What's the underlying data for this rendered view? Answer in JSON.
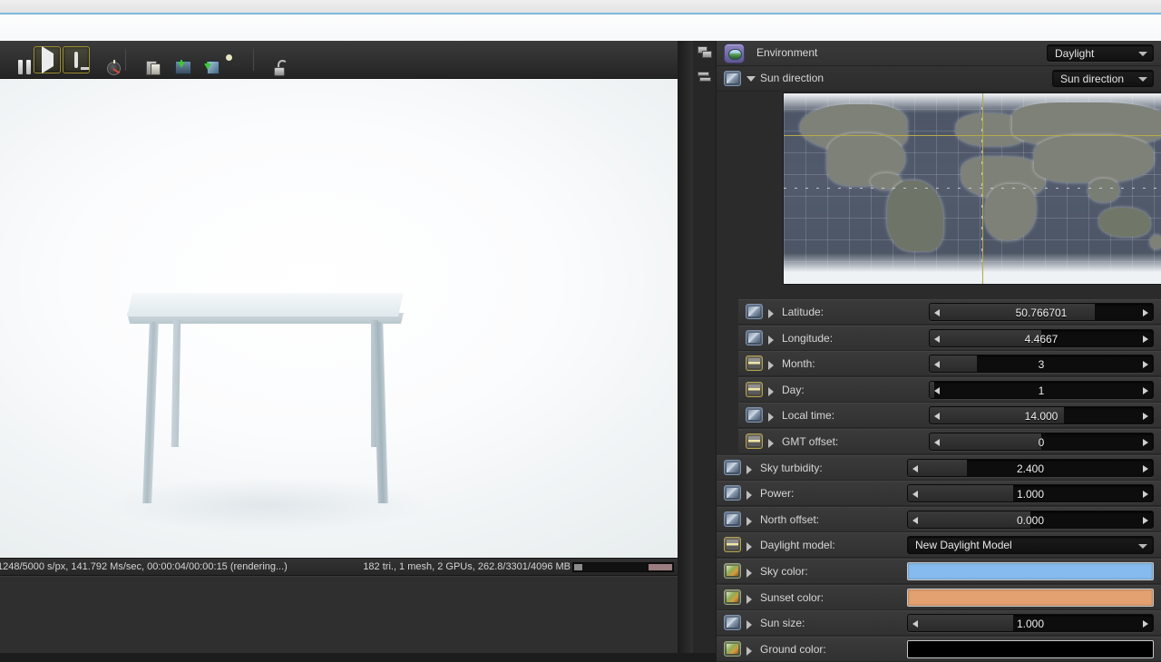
{
  "browser": {
    "present": true
  },
  "render_toolbar": {
    "buttons": [
      {
        "name": "pause-render-button",
        "icon": "pause-icon",
        "active": false
      },
      {
        "name": "start-render-button",
        "icon": "play-icon",
        "active": true
      },
      {
        "name": "region-render-button",
        "icon": "monitor-icon",
        "active": true
      },
      {
        "name": "render-priority-button",
        "icon": "gauge-icon",
        "active": false
      },
      {
        "name": "copy-to-clipboard-button",
        "icon": "clipboard-icon",
        "active": false
      },
      {
        "name": "save-image-button",
        "icon": "save-image-icon",
        "active": false
      },
      {
        "name": "save-object-button",
        "icon": "save-object-icon",
        "active": false
      },
      {
        "name": "save-render-passes-button",
        "icon": "film-image-icon",
        "active": false
      },
      {
        "name": "lock-resolution-button",
        "icon": "unlock-icon",
        "active": false
      }
    ]
  },
  "render_status": {
    "left": "1248/5000 s/px, 141.792 Ms/sec, 00:00:04/00:00:15 (rendering...)",
    "right": "182 tri., 1 mesh, 2 GPUs, 262.8/3301/4096 MB",
    "samples_done": 1248,
    "samples_total": 5000,
    "speed": "141.792 Ms/sec",
    "elapsed": "00:00:04",
    "estimated": "00:00:15",
    "state": "rendering...",
    "triangles": "182 tri.",
    "meshes": "1 mesh",
    "gpus": "2 GPUs",
    "memory": "262.8/3301/4096 MB"
  },
  "panel": {
    "header": {
      "title": "Environment",
      "preset": "Daylight",
      "icon": "environment-globe-icon"
    },
    "rail_icons": [
      "panel-stack-icon",
      "panel-list-icon"
    ],
    "group": {
      "label": "Sun direction",
      "mode": "Sun direction",
      "expanded": true,
      "toggle_type": "curve"
    },
    "map": {
      "name": "world-map",
      "latitude": 50.766701,
      "longitude": 4.4667
    },
    "params": [
      {
        "label": "Latitude:",
        "value": "50.766701",
        "control": "slider",
        "fill": 74,
        "toggle": "curve",
        "inset": true
      },
      {
        "label": "Longitude:",
        "value": "4.4667",
        "control": "slider",
        "fill": 50,
        "toggle": "curve",
        "inset": true
      },
      {
        "label": "Month:",
        "value": "3",
        "control": "slider",
        "fill": 21,
        "toggle": "step",
        "inset": true
      },
      {
        "label": "Day:",
        "value": "1",
        "control": "slider",
        "fill": 2,
        "toggle": "step",
        "inset": true
      },
      {
        "label": "Local time:",
        "value": "14.000",
        "control": "slider",
        "fill": 60,
        "toggle": "curve",
        "inset": true
      },
      {
        "label": "GMT offset:",
        "value": "0",
        "control": "slider",
        "fill": 50,
        "toggle": "step",
        "inset": true
      },
      {
        "label": "Sky turbidity:",
        "value": "2.400",
        "control": "slider",
        "fill": 24,
        "toggle": "curve",
        "inset": false
      },
      {
        "label": "Power:",
        "value": "1.000",
        "control": "slider",
        "fill": 43,
        "toggle": "curve",
        "inset": false
      },
      {
        "label": "North offset:",
        "value": "0.000",
        "control": "slider",
        "fill": 50,
        "toggle": "curve",
        "inset": false
      },
      {
        "label": "Daylight model:",
        "value": "New Daylight Model",
        "control": "combo",
        "toggle": "step",
        "inset": false
      },
      {
        "label": "Sky color:",
        "value": "#85bbee",
        "control": "swatch",
        "toggle": "grad",
        "inset": false
      },
      {
        "label": "Sunset color:",
        "value": "#e3a070",
        "control": "swatch",
        "toggle": "grad",
        "inset": false
      },
      {
        "label": "Sun size:",
        "value": "1.000",
        "control": "slider",
        "fill": 43,
        "toggle": "curve",
        "inset": false
      },
      {
        "label": "Ground color:",
        "value": "#000000",
        "control": "swatch",
        "toggle": "grad",
        "inset": false
      }
    ]
  },
  "colors": {
    "accent_highlight": "#9d8f2e",
    "panel_bg": "#2b2b2b",
    "row_bg": "#3a3a3a",
    "sky_color": "#85bbee",
    "sunset_color": "#e3a070",
    "ground_color": "#000000",
    "crosshair": "#b9a84a"
  }
}
